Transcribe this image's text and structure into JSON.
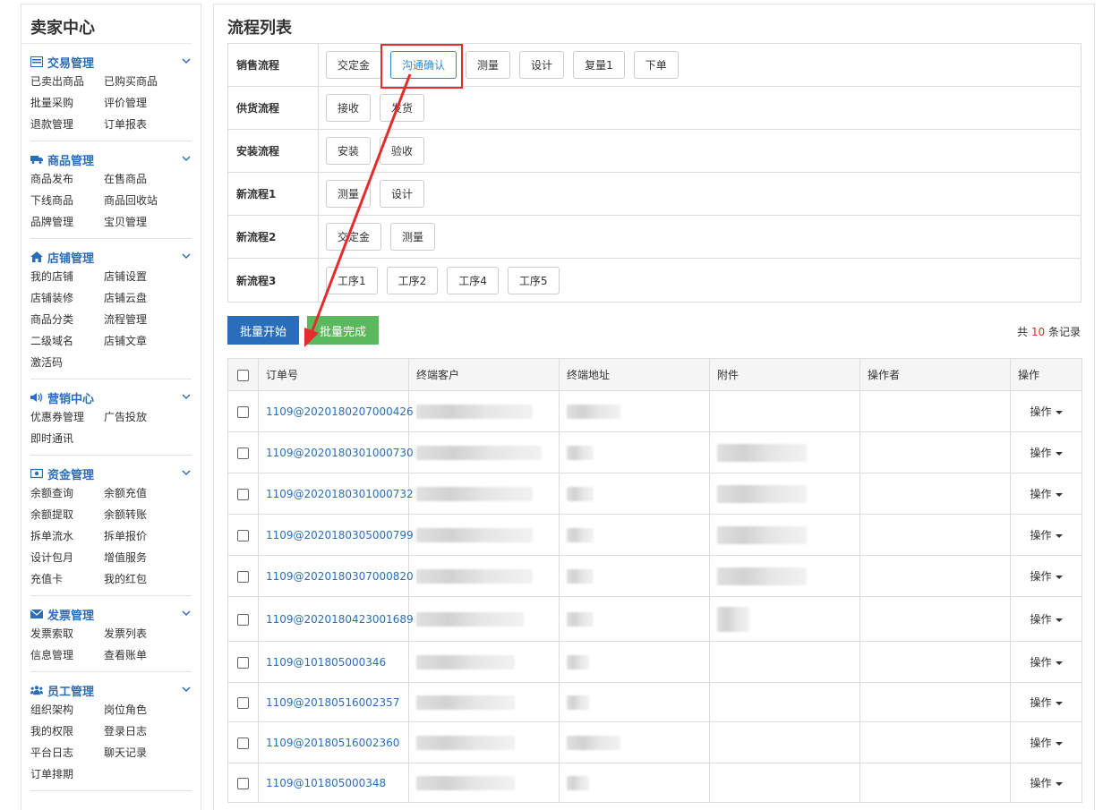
{
  "sidebar": {
    "title": "卖家中心",
    "sections": [
      {
        "label": "交易管理",
        "icon": "list-icon",
        "items": [
          "已卖出商品",
          "已购买商品",
          "批量采购",
          "评价管理",
          "退款管理",
          "订单报表"
        ]
      },
      {
        "label": "商品管理",
        "icon": "truck-icon",
        "items": [
          "商品发布",
          "在售商品",
          "下线商品",
          "商品回收站",
          "品牌管理",
          "宝贝管理"
        ]
      },
      {
        "label": "店铺管理",
        "icon": "home-icon",
        "items": [
          "我的店铺",
          "店铺设置",
          "店铺装修",
          "店铺云盘",
          "商品分类",
          "流程管理",
          "二级域名",
          "店铺文章",
          "激活码"
        ]
      },
      {
        "label": "营销中心",
        "icon": "speaker-icon",
        "items": [
          "优惠券管理",
          "广告投放",
          "即时通讯"
        ]
      },
      {
        "label": "资金管理",
        "icon": "money-icon",
        "items": [
          "余额查询",
          "余额充值",
          "余额提取",
          "余额转账",
          "拆单流水",
          "拆单报价",
          "设计包月",
          "增值服务",
          "充值卡",
          "我的红包"
        ]
      },
      {
        "label": "发票管理",
        "icon": "envelope-icon",
        "items": [
          "发票索取",
          "发票列表",
          "信息管理",
          "查看账单"
        ]
      },
      {
        "label": "员工管理",
        "icon": "users-icon",
        "items": [
          "组织架构",
          "岗位角色",
          "我的权限",
          "登录日志",
          "平台日志",
          "聊天记录",
          "订单排期"
        ]
      }
    ]
  },
  "main": {
    "title": "流程列表",
    "flows": [
      {
        "name": "销售流程",
        "steps": [
          "交定金",
          "沟通确认",
          "测量",
          "设计",
          "复量1",
          "下单"
        ],
        "active": 1
      },
      {
        "name": "供货流程",
        "steps": [
          "接收",
          "发货"
        ],
        "active": -1
      },
      {
        "name": "安装流程",
        "steps": [
          "安装",
          "验收"
        ],
        "active": -1
      },
      {
        "name": "新流程1",
        "steps": [
          "测量",
          "设计"
        ],
        "active": -1
      },
      {
        "name": "新流程2",
        "steps": [
          "交定金",
          "测量"
        ],
        "active": -1
      },
      {
        "name": "新流程3",
        "steps": [
          "工序1",
          "工序2",
          "工序4",
          "工序5"
        ],
        "active": -1
      }
    ],
    "batch_start": "批量开始",
    "batch_done": "批量完成",
    "record_prefix": "共",
    "record_count": "10",
    "record_suffix": "条记录",
    "columns": [
      "订单号",
      "终端客户",
      "终端地址",
      "附件",
      "操作者",
      "操作"
    ],
    "rows": [
      {
        "order": "1109@2020180207000426",
        "op": "操作",
        "has_attach": false
      },
      {
        "order": "1109@2020180301000730",
        "op": "操作",
        "has_attach": true
      },
      {
        "order": "1109@2020180301000732",
        "op": "操作",
        "has_attach": true
      },
      {
        "order": "1109@2020180305000799",
        "op": "操作",
        "has_attach": true
      },
      {
        "order": "1109@2020180307000820",
        "op": "操作",
        "has_attach": true
      },
      {
        "order": "1109@2020180423001689",
        "op": "操作",
        "has_attach": true
      },
      {
        "order": "1109@101805000346",
        "op": "操作",
        "has_attach": false
      },
      {
        "order": "1109@20180516002357",
        "op": "操作",
        "has_attach": false
      },
      {
        "order": "1109@20180516002360",
        "op": "操作",
        "has_attach": false
      },
      {
        "order": "1109@101805000348",
        "op": "操作",
        "has_attach": false
      }
    ]
  },
  "colors": {
    "accent": "#2a6ebb",
    "success": "#5cb85c",
    "annotation": "#e52b2b"
  }
}
